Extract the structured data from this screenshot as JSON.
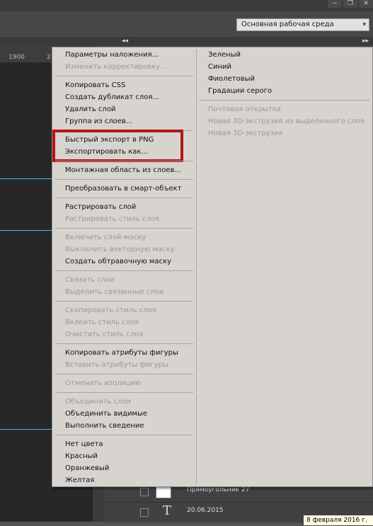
{
  "workspace": {
    "label": "Основная рабочая среда"
  },
  "window_controls": {
    "minimize": "−",
    "restore": "❐",
    "close": "✕"
  },
  "panel_collapse": {
    "left": "◂◂",
    "right": "▸▸"
  },
  "ruler": {
    "tick_1900": "1900",
    "tick_partial": "2"
  },
  "layers": [
    {
      "name": "Прямоугольник 27"
    },
    {
      "name": "20.06.2015"
    }
  ],
  "tooltip": {
    "text": "8 февраля 2016 г."
  },
  "menu": {
    "left": [
      {
        "label": "Параметры наложения...",
        "enabled": true
      },
      {
        "label": "Изменить корректировку...",
        "enabled": false
      },
      {
        "label": "Копировать CSS",
        "enabled": true
      },
      {
        "label": "Создать дубликат слоя...",
        "enabled": true
      },
      {
        "label": "Удалить слой",
        "enabled": true
      },
      {
        "label": "Группа из слоев...",
        "enabled": true
      },
      {
        "label": "Быстрый экспорт в PNG",
        "enabled": true
      },
      {
        "label": "Экспортировать как...",
        "enabled": true
      },
      {
        "label": "Монтажная область из слоев...",
        "enabled": true
      },
      {
        "label": "Преобразовать в смарт-объект",
        "enabled": true
      },
      {
        "label": "Растрировать слой",
        "enabled": true
      },
      {
        "label": "Растрировать стиль слоя",
        "enabled": false
      },
      {
        "label": "Включить слой-маску",
        "enabled": false
      },
      {
        "label": "Выключить векторную маску",
        "enabled": false
      },
      {
        "label": "Создать обтравочную маску",
        "enabled": true
      },
      {
        "label": "Связать слои",
        "enabled": false
      },
      {
        "label": "Выделить связанные слои",
        "enabled": false
      },
      {
        "label": "Скопировать стиль слоя",
        "enabled": false
      },
      {
        "label": "Вклеить стиль слоя",
        "enabled": false
      },
      {
        "label": "Очистить стиль слоя",
        "enabled": false
      },
      {
        "label": "Копировать атрибуты фигуры",
        "enabled": true
      },
      {
        "label": "Вставить атрибуты фигуры",
        "enabled": false
      },
      {
        "label": "Отменить изоляцию",
        "enabled": false
      },
      {
        "label": "Объединить слои",
        "enabled": false
      },
      {
        "label": "Объединить видимые",
        "enabled": true
      },
      {
        "label": "Выполнить сведение",
        "enabled": true
      },
      {
        "label": "Нет цвета",
        "enabled": true
      },
      {
        "label": "Красный",
        "enabled": true
      },
      {
        "label": "Оранжевый",
        "enabled": true
      },
      {
        "label": "Желтая",
        "enabled": true
      }
    ],
    "right": [
      {
        "label": "Зеленый",
        "enabled": true
      },
      {
        "label": "Синий",
        "enabled": true
      },
      {
        "label": "Фиолетовый",
        "enabled": true
      },
      {
        "label": "Градации серого",
        "enabled": true
      },
      {
        "label": "Почтовая открытка",
        "enabled": false
      },
      {
        "label": "Новая 3D-экструзия из выделенного слоя",
        "enabled": false
      },
      {
        "label": "Новая 3D-экструзия",
        "enabled": false
      }
    ]
  },
  "colors": {
    "menu_bg": "#d7d4cf",
    "highlight_border": "#b3151a",
    "guide": "#31c9d9"
  }
}
